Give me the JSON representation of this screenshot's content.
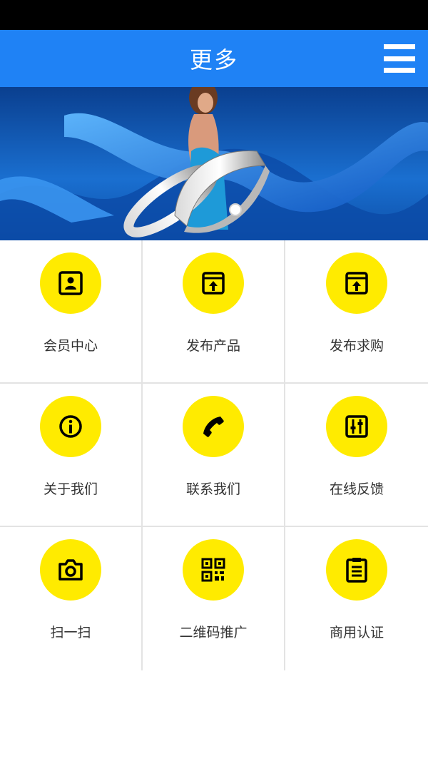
{
  "header": {
    "title": "更多"
  },
  "menu": {
    "items": [
      {
        "label": "会员中心",
        "icon": "member-card-icon"
      },
      {
        "label": "发布产品",
        "icon": "upload-window-icon"
      },
      {
        "label": "发布求购",
        "icon": "upload-window-icon"
      },
      {
        "label": "关于我们",
        "icon": "info-icon"
      },
      {
        "label": "联系我们",
        "icon": "phone-icon"
      },
      {
        "label": "在线反馈",
        "icon": "sliders-icon"
      },
      {
        "label": "扫一扫",
        "icon": "camera-icon"
      },
      {
        "label": "二维码推广",
        "icon": "qr-code-icon"
      },
      {
        "label": "商用认证",
        "icon": "clipboard-icon"
      }
    ]
  },
  "colors": {
    "header": "#1f82f5",
    "icon_circle": "#ffeb00",
    "icon": "#000000"
  }
}
